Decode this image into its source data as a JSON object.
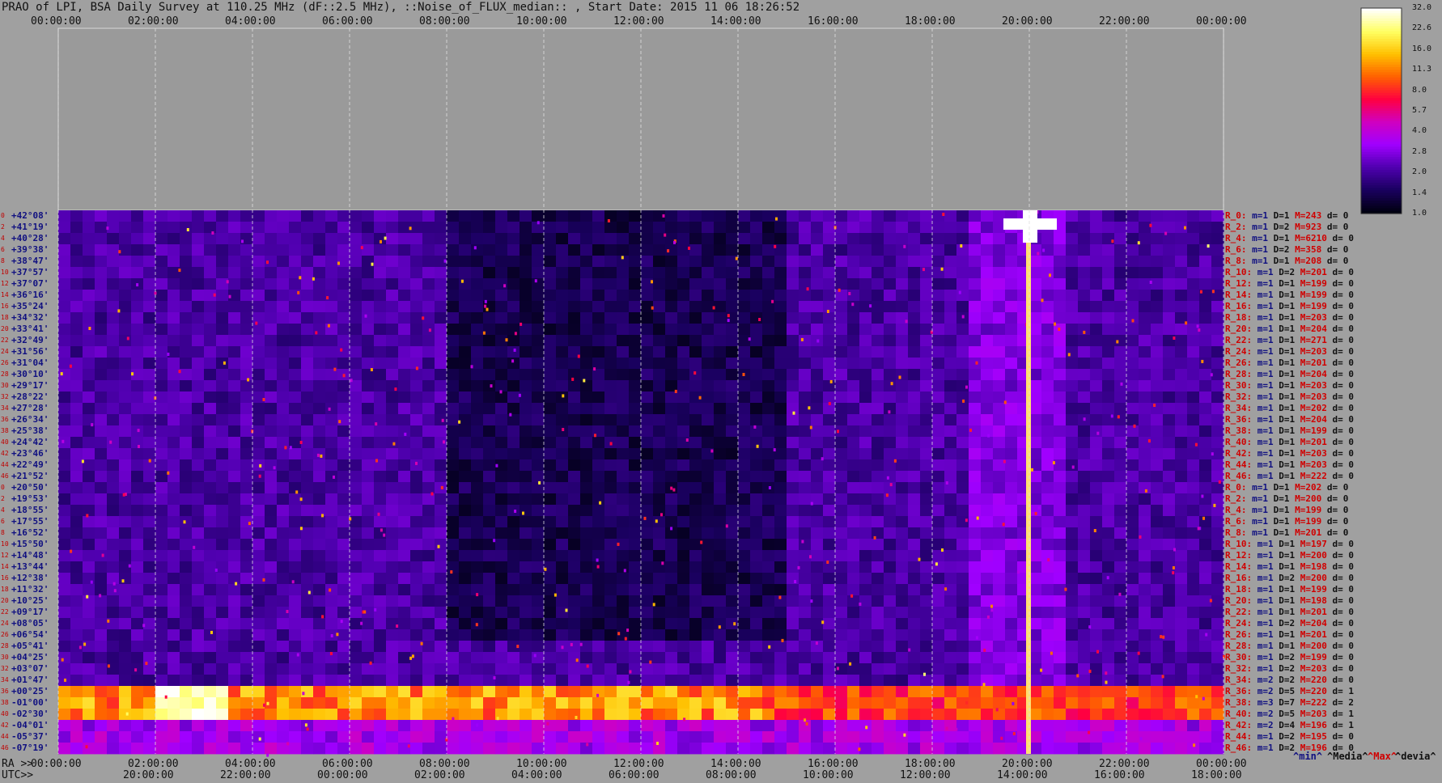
{
  "header": {
    "title": "PRAO of LPI, BSA Daily Survey at 110.25 MHz (dF::2.5 MHz), ::Noise_of_FLUX_median:: , Start Date: 2015 11 06 18:26:52"
  },
  "chart_data": {
    "type": "heatmap",
    "top_axis_utc_ticks": [
      "00:00:00",
      "02:00:00",
      "04:00:00",
      "06:00:00",
      "08:00:00",
      "10:00:00",
      "12:00:00",
      "14:00:00",
      "16:00:00",
      "18:00:00",
      "20:00:00",
      "22:00:00",
      "00:00:00"
    ],
    "bottom_axis_ra_label": "RA >>",
    "bottom_axis_ra_ticks": [
      "00:00:00",
      "02:00:00",
      "04:00:00",
      "06:00:00",
      "08:00:00",
      "10:00:00",
      "12:00:00",
      "14:00:00",
      "16:00:00",
      "18:00:00",
      "20:00:00",
      "22:00:00",
      "00:00:00"
    ],
    "bottom_axis_utc_label": "UTC>>",
    "bottom_axis_utc_ticks": [
      "20:00:00",
      "22:00:00",
      "00:00:00",
      "02:00:00",
      "04:00:00",
      "06:00:00",
      "08:00:00",
      "10:00:00",
      "12:00:00",
      "14:00:00",
      "16:00:00",
      "18:00:00"
    ],
    "declinations": [
      "+42°08'",
      "+41°19'",
      "+40°28'",
      "+39°38'",
      "+38°47'",
      "+37°57'",
      "+37°07'",
      "+36°16'",
      "+35°24'",
      "+34°32'",
      "+33°41'",
      "+32°49'",
      "+31°56'",
      "+31°04'",
      "+30°10'",
      "+29°17'",
      "+28°22'",
      "+27°28'",
      "+26°34'",
      "+25°38'",
      "+24°42'",
      "+23°46'",
      "+22°49'",
      "+21°52'",
      "+20°50'",
      "+19°53'",
      "+18°55'",
      "+17°55'",
      "+16°52'",
      "+15°50'",
      "+14°48'",
      "+13°44'",
      "+12°38'",
      "+11°32'",
      "+10°25'",
      "+09°17'",
      "+08°05'",
      "+06°54'",
      "+05°41'",
      "+04°25'",
      "+03°07'",
      "+01°47'",
      "+00°25'",
      "-01°00'",
      "-02°30'",
      "-04°01'",
      "-05°37'",
      "-07°19'"
    ],
    "row_indices": [
      "0",
      "2",
      "4",
      "6",
      "8",
      "10",
      "12",
      "14",
      "16",
      "18",
      "20",
      "22",
      "24",
      "26",
      "28",
      "30",
      "32",
      "34",
      "36",
      "38",
      "40",
      "42",
      "44",
      "46",
      "0",
      "2",
      "4",
      "6",
      "8",
      "10",
      "12",
      "14",
      "16",
      "18",
      "20",
      "22",
      "24",
      "26",
      "28",
      "30",
      "32",
      "34",
      "36",
      "38",
      "40",
      "42",
      "44",
      "46"
    ],
    "receiver_stats": [
      {
        "r": "R_0:",
        "m": "m=1",
        "d": "D=1",
        "mm": "M=243",
        "dv": "d= 0"
      },
      {
        "r": "R_2:",
        "m": "m=1",
        "d": "D=2",
        "mm": "M=923",
        "dv": "d= 0"
      },
      {
        "r": "R_4:",
        "m": "m=1",
        "d": "D=1",
        "mm": "M=6210",
        "dv": "d= 0"
      },
      {
        "r": "R_6:",
        "m": "m=1",
        "d": "D=2",
        "mm": "M=358",
        "dv": "d= 0"
      },
      {
        "r": "R_8:",
        "m": "m=1",
        "d": "D=1",
        "mm": "M=208",
        "dv": "d= 0"
      },
      {
        "r": "R_10:",
        "m": "m=1",
        "d": "D=2",
        "mm": "M=201",
        "dv": "d= 0"
      },
      {
        "r": "R_12:",
        "m": "m=1",
        "d": "D=1",
        "mm": "M=199",
        "dv": "d= 0"
      },
      {
        "r": "R_14:",
        "m": "m=1",
        "d": "D=1",
        "mm": "M=199",
        "dv": "d= 0"
      },
      {
        "r": "R_16:",
        "m": "m=1",
        "d": "D=1",
        "mm": "M=199",
        "dv": "d= 0"
      },
      {
        "r": "R_18:",
        "m": "m=1",
        "d": "D=1",
        "mm": "M=203",
        "dv": "d= 0"
      },
      {
        "r": "R_20:",
        "m": "m=1",
        "d": "D=1",
        "mm": "M=204",
        "dv": "d= 0"
      },
      {
        "r": "R_22:",
        "m": "m=1",
        "d": "D=1",
        "mm": "M=271",
        "dv": "d= 0"
      },
      {
        "r": "R_24:",
        "m": "m=1",
        "d": "D=1",
        "mm": "M=203",
        "dv": "d= 0"
      },
      {
        "r": "R_26:",
        "m": "m=1",
        "d": "D=1",
        "mm": "M=201",
        "dv": "d= 0"
      },
      {
        "r": "R_28:",
        "m": "m=1",
        "d": "D=1",
        "mm": "M=204",
        "dv": "d= 0"
      },
      {
        "r": "R_30:",
        "m": "m=1",
        "d": "D=1",
        "mm": "M=203",
        "dv": "d= 0"
      },
      {
        "r": "R_32:",
        "m": "m=1",
        "d": "D=1",
        "mm": "M=203",
        "dv": "d= 0"
      },
      {
        "r": "R_34:",
        "m": "m=1",
        "d": "D=1",
        "mm": "M=202",
        "dv": "d= 0"
      },
      {
        "r": "R_36:",
        "m": "m=1",
        "d": "D=1",
        "mm": "M=204",
        "dv": "d= 0"
      },
      {
        "r": "R_38:",
        "m": "m=1",
        "d": "D=1",
        "mm": "M=199",
        "dv": "d= 0"
      },
      {
        "r": "R_40:",
        "m": "m=1",
        "d": "D=1",
        "mm": "M=201",
        "dv": "d= 0"
      },
      {
        "r": "R_42:",
        "m": "m=1",
        "d": "D=1",
        "mm": "M=203",
        "dv": "d= 0"
      },
      {
        "r": "R_44:",
        "m": "m=1",
        "d": "D=1",
        "mm": "M=203",
        "dv": "d= 0"
      },
      {
        "r": "R_46:",
        "m": "m=1",
        "d": "D=1",
        "mm": "M=222",
        "dv": "d= 0"
      },
      {
        "r": "R_0:",
        "m": "m=1",
        "d": "D=1",
        "mm": "M=202",
        "dv": "d= 0"
      },
      {
        "r": "R_2:",
        "m": "m=1",
        "d": "D=1",
        "mm": "M=200",
        "dv": "d= 0"
      },
      {
        "r": "R_4:",
        "m": "m=1",
        "d": "D=1",
        "mm": "M=199",
        "dv": "d= 0"
      },
      {
        "r": "R_6:",
        "m": "m=1",
        "d": "D=1",
        "mm": "M=199",
        "dv": "d= 0"
      },
      {
        "r": "R_8:",
        "m": "m=1",
        "d": "D=1",
        "mm": "M=201",
        "dv": "d= 0"
      },
      {
        "r": "R_10:",
        "m": "m=1",
        "d": "D=1",
        "mm": "M=197",
        "dv": "d= 0"
      },
      {
        "r": "R_12:",
        "m": "m=1",
        "d": "D=1",
        "mm": "M=200",
        "dv": "d= 0"
      },
      {
        "r": "R_14:",
        "m": "m=1",
        "d": "D=1",
        "mm": "M=198",
        "dv": "d= 0"
      },
      {
        "r": "R_16:",
        "m": "m=1",
        "d": "D=2",
        "mm": "M=200",
        "dv": "d= 0"
      },
      {
        "r": "R_18:",
        "m": "m=1",
        "d": "D=1",
        "mm": "M=199",
        "dv": "d= 0"
      },
      {
        "r": "R_20:",
        "m": "m=1",
        "d": "D=1",
        "mm": "M=198",
        "dv": "d= 0"
      },
      {
        "r": "R_22:",
        "m": "m=1",
        "d": "D=1",
        "mm": "M=201",
        "dv": "d= 0"
      },
      {
        "r": "R_24:",
        "m": "m=1",
        "d": "D=2",
        "mm": "M=204",
        "dv": "d= 0"
      },
      {
        "r": "R_26:",
        "m": "m=1",
        "d": "D=1",
        "mm": "M=201",
        "dv": "d= 0"
      },
      {
        "r": "R_28:",
        "m": "m=1",
        "d": "D=1",
        "mm": "M=200",
        "dv": "d= 0"
      },
      {
        "r": "R_30:",
        "m": "m=1",
        "d": "D=2",
        "mm": "M=199",
        "dv": "d= 0"
      },
      {
        "r": "R_32:",
        "m": "m=1",
        "d": "D=2",
        "mm": "M=203",
        "dv": "d= 0"
      },
      {
        "r": "R_34:",
        "m": "m=2",
        "d": "D=2",
        "mm": "M=220",
        "dv": "d= 0"
      },
      {
        "r": "R_36:",
        "m": "m=2",
        "d": "D=5",
        "mm": "M=220",
        "dv": "d= 1"
      },
      {
        "r": "R_38:",
        "m": "m=3",
        "d": "D=7",
        "mm": "M=222",
        "dv": "d= 2"
      },
      {
        "r": "R_40:",
        "m": "m=2",
        "d": "D=5",
        "mm": "M=203",
        "dv": "d= 1"
      },
      {
        "r": "R_42:",
        "m": "m=2",
        "d": "D=4",
        "mm": "M=196",
        "dv": "d= 1"
      },
      {
        "r": "R_44:",
        "m": "m=1",
        "d": "D=2",
        "mm": "M=195",
        "dv": "d= 0"
      },
      {
        "r": "R_46:",
        "m": "m=1",
        "d": "D=2",
        "mm": "M=196",
        "dv": "d= 0"
      }
    ],
    "colorbar": {
      "ticks": [
        "32.0",
        "22.6",
        "16.0",
        "11.3",
        "8.0",
        "5.7",
        "4.0",
        "2.8",
        "2.0",
        "1.4",
        "1.0"
      ],
      "range": [
        1.0,
        32.0
      ],
      "scale": "log2",
      "colors": [
        "#000010",
        "#1a0060",
        "#5000b0",
        "#a000ff",
        "#d000c0",
        "#ff0040",
        "#ff6000",
        "#ffc000",
        "#ffff60",
        "#ffffff"
      ]
    },
    "legend": {
      "min": "^min^",
      "median": "^Media^",
      "max": "^Max^",
      "dev": "^devia^"
    },
    "legend_colors": {
      "min": "#101080",
      "median": "#111111",
      "max": "#d00000",
      "dev": "#111111"
    },
    "features": {
      "bright_band_rows": [
        "+00°25'",
        "-01°00'",
        "-02°30'"
      ],
      "bright_source_utc": "20:00:00",
      "bright_source_dec": "+41°19'"
    }
  }
}
